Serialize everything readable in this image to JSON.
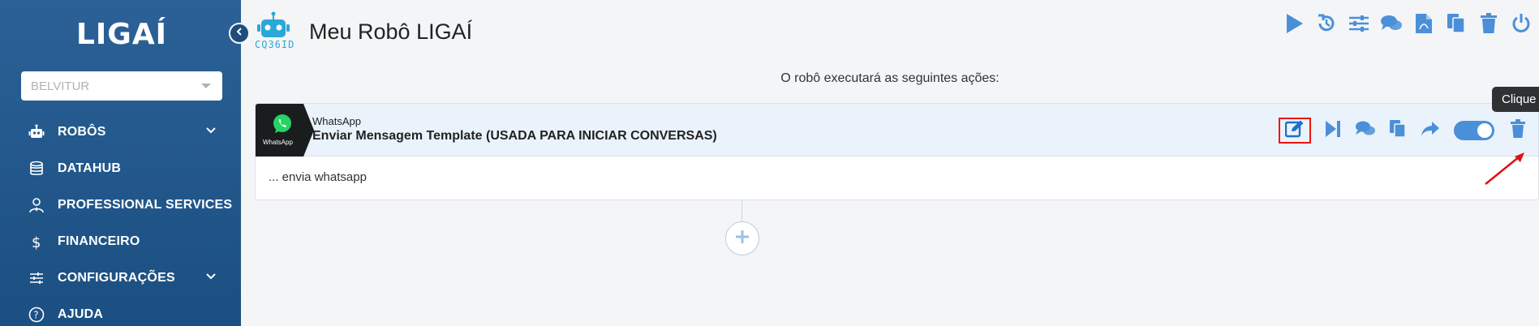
{
  "sidebar": {
    "logo": "LIGAÍ",
    "company_select": {
      "value": "BELVITUR"
    },
    "items": [
      {
        "label": "ROBÔS",
        "icon": "robot-icon",
        "expandable": true
      },
      {
        "label": "DATAHUB",
        "icon": "database-icon",
        "expandable": false
      },
      {
        "label": "PROFESSIONAL SERVICES",
        "icon": "user-tie-icon",
        "expandable": false
      },
      {
        "label": "FINANCEIRO",
        "icon": "dollar-icon",
        "expandable": false
      },
      {
        "label": "CONFIGURAÇÕES",
        "icon": "sliders-icon",
        "expandable": true
      },
      {
        "label": "AJUDA",
        "icon": "help-circle-icon",
        "expandable": false
      }
    ]
  },
  "header": {
    "bot_code": "CQ36ID",
    "title": "Meu Robô LIGAÍ",
    "actions": [
      "play-icon",
      "history-icon",
      "sliders-icon",
      "comments-icon",
      "pdf-icon",
      "copy-icon",
      "trash-icon",
      "power-icon"
    ]
  },
  "main": {
    "subtitle": "O robô executará as seguintes ações:",
    "action_card": {
      "badge_text": "WhatsApp",
      "type": "WhatsApp",
      "name": "Enviar Mensagem Template (USADA PARA INICIAR CONVERSAS)",
      "description": "... envia whatsapp",
      "enabled": true
    },
    "tooltip": "Clique para editar"
  },
  "colors": {
    "sidebar_bg": "#245a8f",
    "accent": "#4a90d9",
    "highlight": "#e11111",
    "card_header": "#eaf3fb"
  }
}
